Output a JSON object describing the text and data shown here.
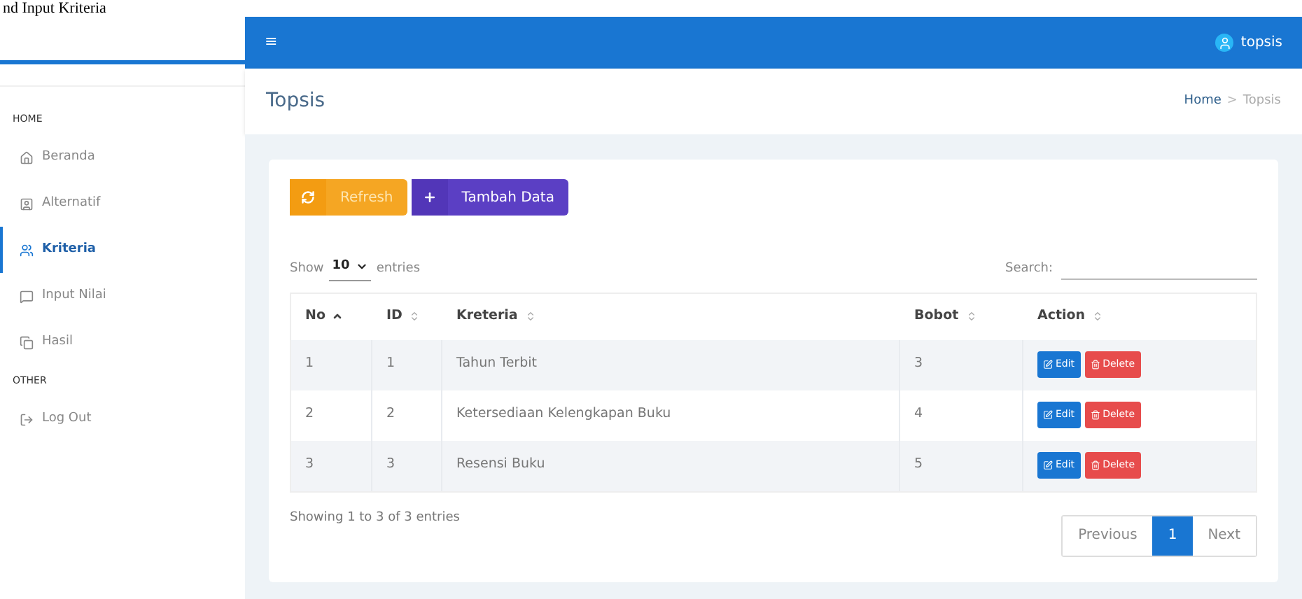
{
  "caption": "nd Input Kriteria",
  "topbar": {
    "menu_glyph": "≡",
    "user": "topsis"
  },
  "sidebar": {
    "sections": [
      {
        "title": "HOME",
        "items": [
          {
            "label": "Beranda",
            "selected": false
          },
          {
            "label": "Alternatif",
            "selected": false
          },
          {
            "label": "Kriteria",
            "selected": true
          },
          {
            "label": "Input Nilai",
            "selected": false
          },
          {
            "label": "Hasil",
            "selected": false
          }
        ]
      },
      {
        "title": "OTHER",
        "items": [
          {
            "label": "Log Out",
            "selected": false
          }
        ]
      }
    ]
  },
  "page_header": {
    "title": "Topsis",
    "separator": ">",
    "breadcrumb": [
      {
        "label": "Home",
        "selected": false
      },
      {
        "label": "Topsis",
        "selected": true
      }
    ]
  },
  "toolbar": [
    {
      "label": "Refresh",
      "kind": "refresh"
    },
    {
      "label": "Tambah Data",
      "kind": "add"
    }
  ],
  "table": {
    "show_label": "Show",
    "length_value": "10",
    "entries_label": "entries",
    "search_label": "Search:",
    "columns": [
      {
        "label": "No",
        "sorted": true
      },
      {
        "label": "ID",
        "sorted": false
      },
      {
        "label": "Kreteria",
        "sorted": false
      },
      {
        "label": "Bobot",
        "sorted": false
      },
      {
        "label": "Action",
        "sorted": false
      }
    ],
    "rows": [
      {
        "cells": [
          "1",
          "1",
          "Tahun Terbit",
          "3"
        ],
        "actions": [
          "Edit",
          "Delete"
        ]
      },
      {
        "cells": [
          "2",
          "2",
          "Ketersediaan Kelengkapan Buku",
          "4"
        ],
        "actions": [
          "Edit",
          "Delete"
        ]
      },
      {
        "cells": [
          "3",
          "3",
          "Resensi Buku",
          "5"
        ],
        "actions": [
          "Edit",
          "Delete"
        ]
      }
    ],
    "info": "Showing 1 to 3 of 3 entries",
    "pagination": [
      {
        "label": "Previous",
        "selected": false
      },
      {
        "label": "1",
        "selected": true
      },
      {
        "label": "Next",
        "selected": false
      }
    ]
  }
}
